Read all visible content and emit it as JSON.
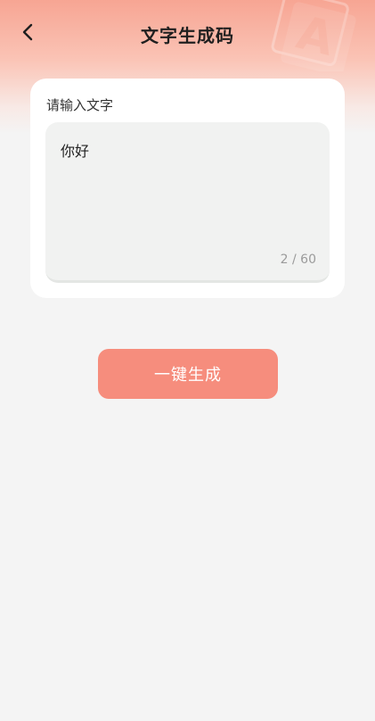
{
  "header": {
    "title": "文字生成码",
    "back_icon": "chevron-left-icon",
    "decoration_text": "A"
  },
  "input_card": {
    "label": "请输入文字",
    "text_value": "你好",
    "counter": "2 / 60"
  },
  "action": {
    "generate_label": "一键生成"
  },
  "colors": {
    "accent": "#f68d7d",
    "header_gradient_top": "#f7a593",
    "background": "#f4f4f4",
    "card": "#ffffff",
    "textarea": "#f1f2f1"
  }
}
